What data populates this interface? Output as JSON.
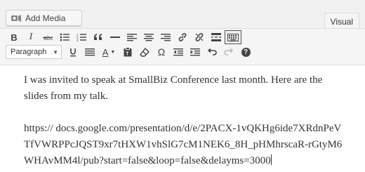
{
  "media": {
    "add_label": "Add Media",
    "icon": "media-camera-music-icon"
  },
  "tabs": [
    {
      "label": "Visual",
      "active": true
    }
  ],
  "toolbar": {
    "row1": [
      "bold",
      "italic",
      "strikethrough",
      "bulleted-list",
      "numbered-list",
      "blockquote",
      "horizontal-line",
      "align-left",
      "align-center",
      "align-right",
      "insert-link",
      "remove-link",
      "insert-read-more",
      "toolbar-toggle"
    ],
    "row2": [
      "format-select",
      "underline",
      "align-justify",
      "text-color",
      "paste-as-text",
      "clear-formatting",
      "special-character",
      "decrease-indent",
      "increase-indent",
      "undo",
      "redo",
      "help"
    ],
    "format_value": "Paragraph",
    "bold_label": "B",
    "italic_label": "I",
    "text_color_label": "A",
    "special_char_label": "Ω",
    "help_label": "?"
  },
  "content": {
    "paragraph1": "I was invited to speak at SmallBiz Conference last month. Here are the slides from my talk.",
    "paragraph2": "https:// docs.google.com/presentation/d/e/2PACX-1vQKHg6ide7XRdnPeVTfVWRPPcJQST9xr7tHXW1vhSlG7cM1NEK6_8H_pHMhrscaR-rGtyM6WHAvMM4l/pub?start=false&loop=false&delayms=3000"
  }
}
